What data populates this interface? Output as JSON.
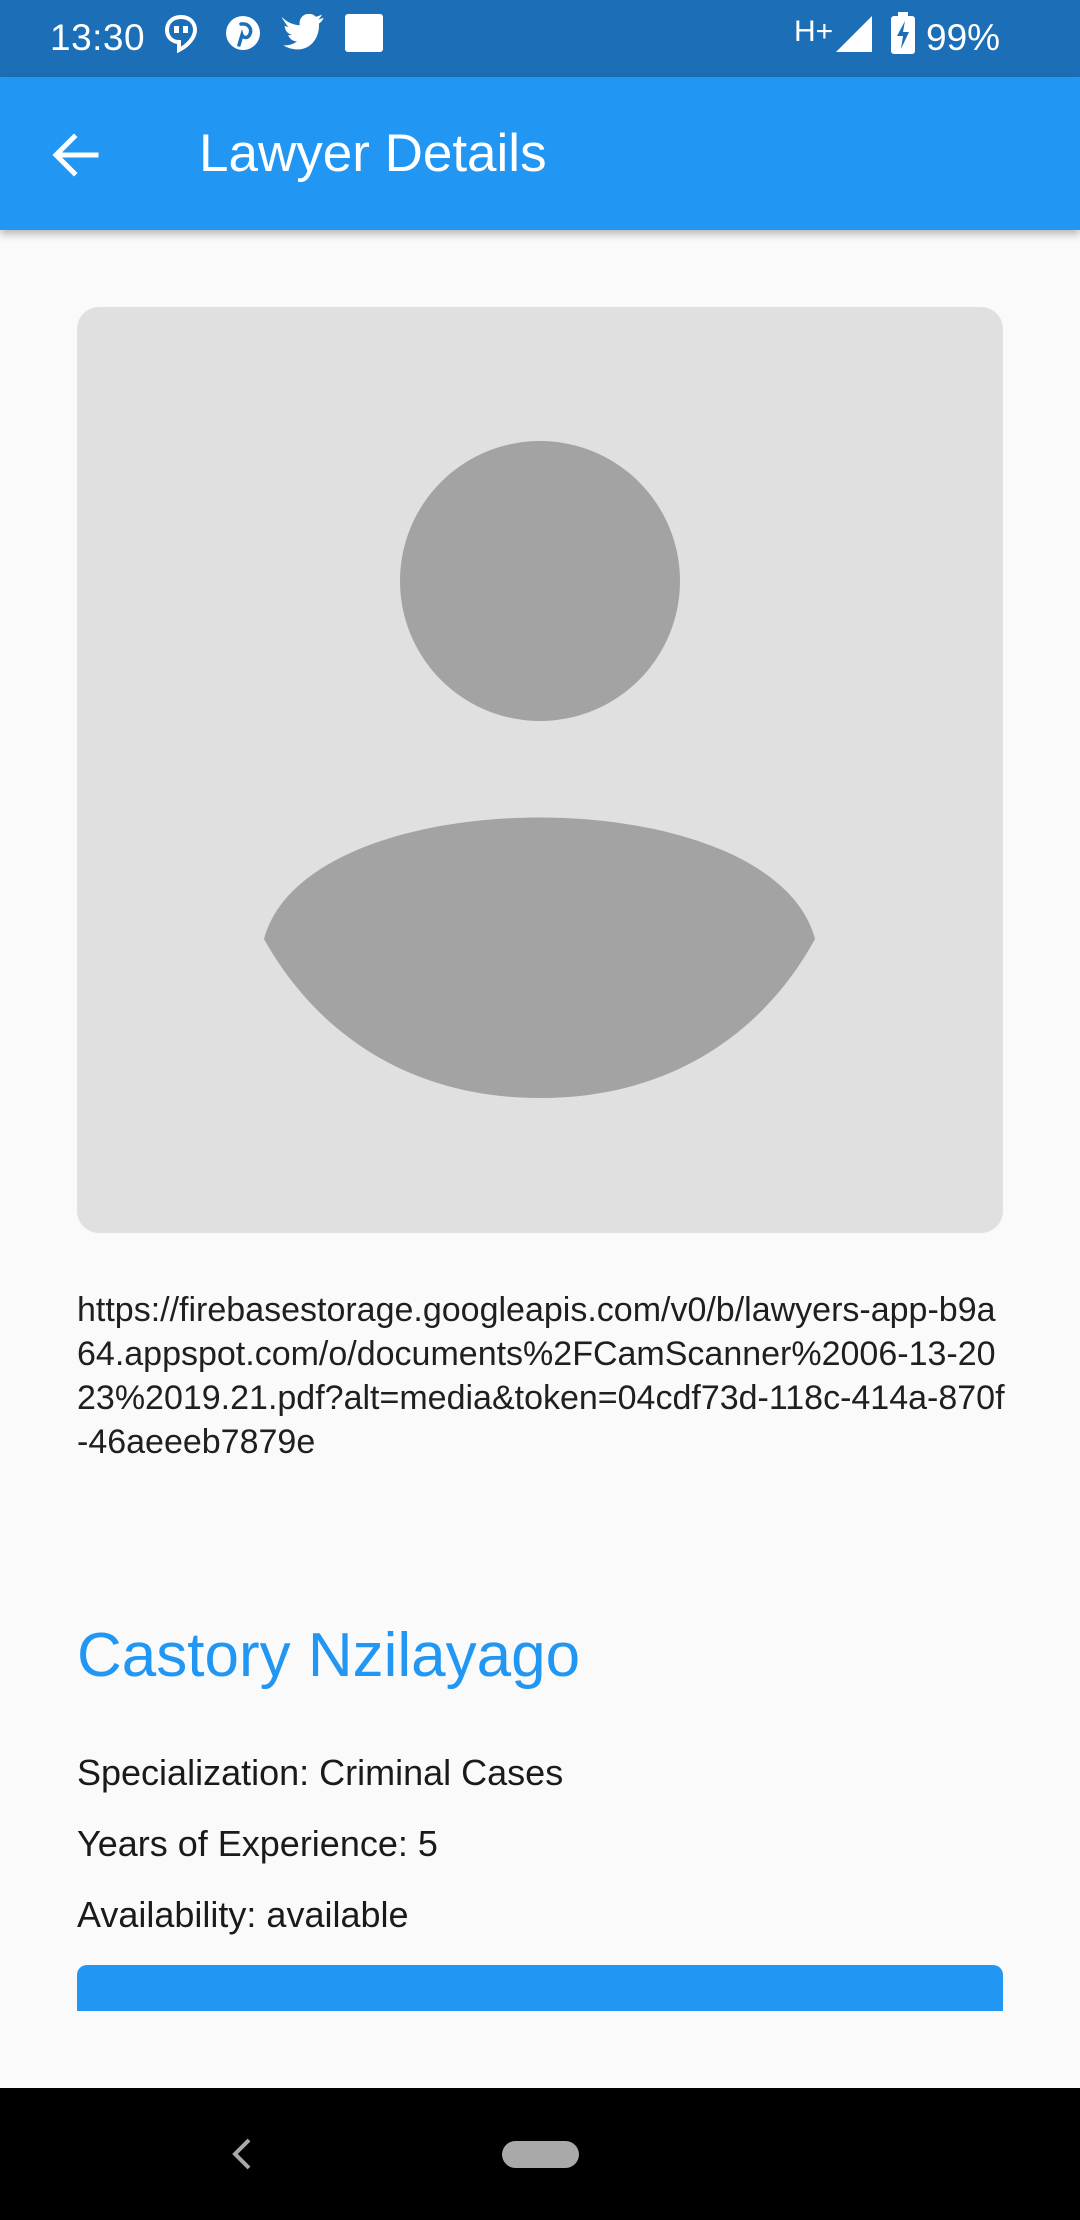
{
  "status_bar": {
    "time": "13:30",
    "network": "H+",
    "battery": "99%",
    "left_icons": [
      "hangouts-icon",
      "pinterest-icon",
      "twitter-icon",
      "square-icon"
    ],
    "right_icons": [
      "signal-icon",
      "battery-charging-icon"
    ]
  },
  "app_bar": {
    "title": "Lawyer Details",
    "back_icon": "arrow-back-icon"
  },
  "profile": {
    "placeholder_icon": "person-silhouette-icon"
  },
  "document_url": "https://firebasestorage.googleapis.com/v0/b/lawyers-app-b9a64.appspot.com/o/documents%2FCamScanner%2006-13-2023%2019.21.pdf?alt=media&token=04cdf73d-118c-414a-870f-46aeeeb7879e",
  "lawyer": {
    "name": "Castory Nzilayago",
    "specialization": "Specialization: Criminal Cases",
    "experience": "Years of Experience: 5",
    "availability": "Availability: available"
  },
  "colors": {
    "status_bar": "#1c6fb6",
    "app_bar": "#2196f3",
    "accent": "#2196f3",
    "background": "#fafafa",
    "card": "#e0e0e0",
    "silhouette": "#a3a3a3"
  }
}
